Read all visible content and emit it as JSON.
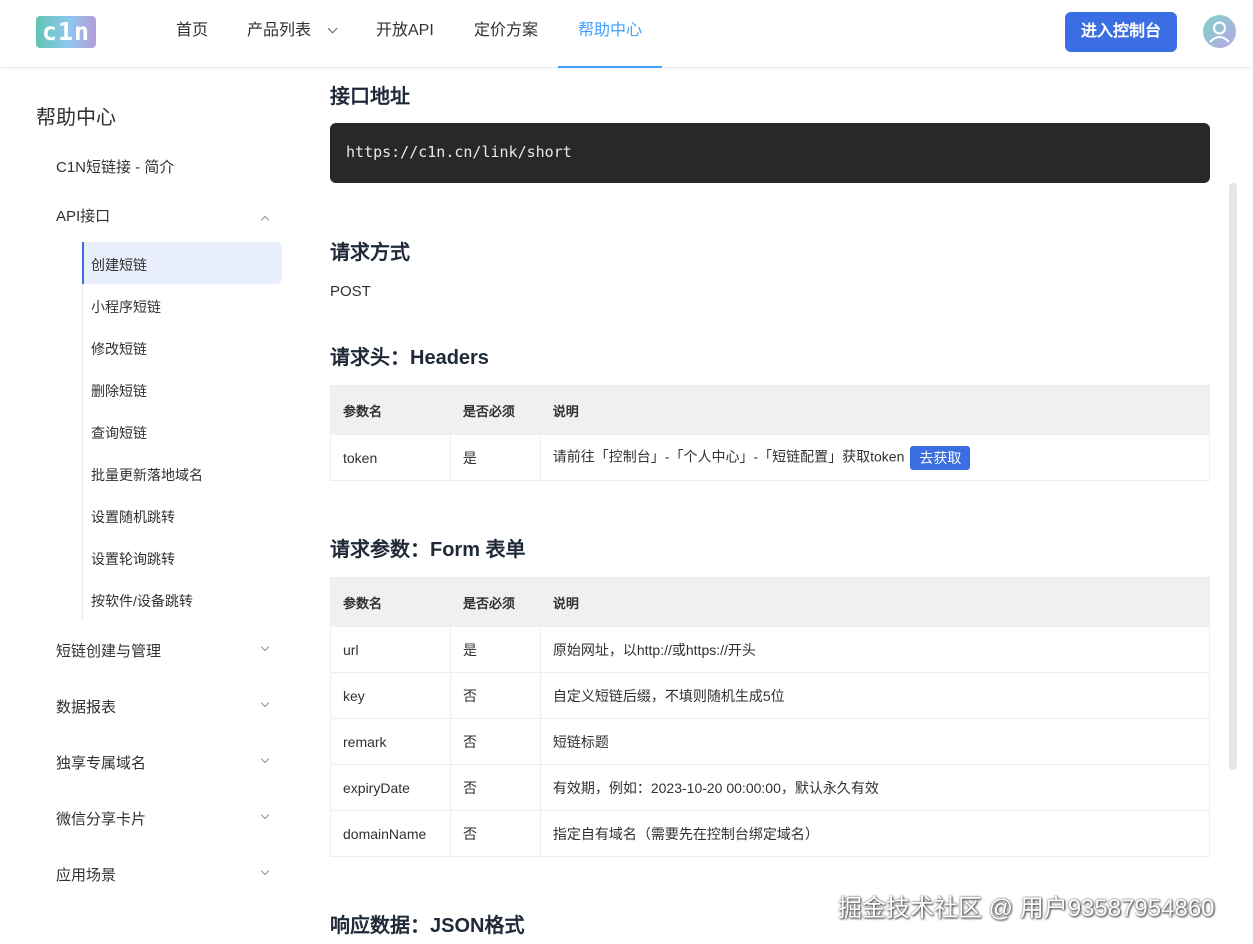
{
  "logo": {
    "text": "c1n"
  },
  "nav": {
    "items": [
      "首页",
      "产品列表",
      "开放API",
      "定价方案",
      "帮助中心"
    ],
    "console_button": "进入控制台"
  },
  "sidebar": {
    "title": "帮助中心",
    "intro": "C1N短链接 - 简介",
    "api": "API接口",
    "sub_items": [
      "创建短链",
      "小程序短链",
      "修改短链",
      "删除短链",
      "查询短链",
      "批量更新落地域名",
      "设置随机跳转",
      "设置轮询跳转",
      "按软件/设备跳转"
    ],
    "groups": [
      "短链创建与管理",
      "数据报表",
      "独享专属域名",
      "微信分享卡片",
      "应用场景"
    ]
  },
  "main": {
    "endpoint_title": "接口地址",
    "endpoint_url": "https://c1n.cn/link/short",
    "method_title": "请求方式",
    "method": "POST",
    "headers_title": "请求头：Headers",
    "headers_table": {
      "columns": [
        "参数名",
        "是否必须",
        "说明"
      ],
      "row": {
        "name": "token",
        "required": "是",
        "desc": "请前往「控制台」-「个人中心」-「短链配置」获取token",
        "button": "去获取"
      }
    },
    "params_title": "请求参数：Form 表单",
    "params_table": {
      "columns": [
        "参数名",
        "是否必须",
        "说明"
      ],
      "rows": [
        {
          "name": "url",
          "required": "是",
          "desc": "原始网址，以http://或https://开头"
        },
        {
          "name": "key",
          "required": "否",
          "desc": "自定义短链后缀，不填则随机生成5位"
        },
        {
          "name": "remark",
          "required": "否",
          "desc": "短链标题"
        },
        {
          "name": "expiryDate",
          "required": "否",
          "desc": "有效期，例如：2023-10-20 00:00:00，默认永久有效"
        },
        {
          "name": "domainName",
          "required": "否",
          "desc": "指定自有域名（需要先在控制台绑定域名）"
        }
      ]
    },
    "response_title": "响应数据：JSON格式"
  },
  "watermark": "掘金技术社区 @ 用户93587954860"
}
